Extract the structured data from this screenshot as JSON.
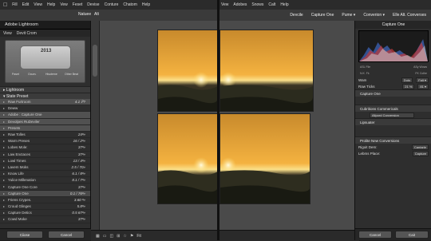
{
  "menubar_left": {
    "apple": "",
    "items": [
      "Fill",
      "Edit",
      "View",
      "Help",
      "Vew",
      "Feset",
      "Devise",
      "Conture",
      "Chatom",
      "Help"
    ]
  },
  "menubar_right": {
    "items": [
      "Vew",
      "Adobes",
      "Snows",
      "Calt",
      "Help"
    ]
  },
  "toolbar": {
    "center_left": "Natuee",
    "center_mid": "Alt",
    "right_items": [
      "Devcile",
      "Capture One",
      "Pume ▾",
      "Converion ▾",
      "Elle Alt. Converses"
    ]
  },
  "left_panel": {
    "title": "Adobe Lightroom",
    "tabs": [
      "View",
      "Devit Crom"
    ],
    "preview": {
      "year": "2013",
      "captions": [
        "Paset",
        "Ooum.",
        "Hisoteme",
        "Other Beat"
      ]
    },
    "section1": "Lightroom",
    "section2": "State Preset",
    "rows": [
      {
        "label": "Raw Furtroom",
        "val": "4.1 ℙ?"
      },
      {
        "label": "Deww",
        "val": ""
      },
      {
        "label": "Adobe : Capture One",
        "val": ""
      },
      {
        "label": "Devolpes RuDeviler",
        "val": ""
      },
      {
        "label": "Presets",
        "val": ""
      },
      {
        "label": "Raw Tolles",
        "val": "24ᵃ»"
      },
      {
        "label": "Warm Preses",
        "val": "16 / 2ᵃ»"
      },
      {
        "label": "Lobes Mole:",
        "val": "37ᵃ»"
      },
      {
        "label": "Law Enctaces",
        "val": "37ᵃ»"
      },
      {
        "label": "Lowl Times",
        "val": "13 / 4ᵃ»"
      },
      {
        "label": "Lavem Moks",
        "val": "2.5 / 70»"
      },
      {
        "label": "Know Life",
        "val": "6.1 / 8ᵃ»"
      },
      {
        "label": "Yulice Millenation",
        "val": "8.1 / 7ᵃ»"
      },
      {
        "label": "Capture One Core",
        "val": "37ᵃ»"
      },
      {
        "label": "Capture One",
        "val": "0.1 / 76ᵃ»"
      },
      {
        "label": "Friens Crypes.",
        "val": "3.60 ᵃ»"
      },
      {
        "label": "Croud Glinges",
        "val": "5.8ᵃ»"
      },
      {
        "label": "Capture Detics",
        "val": "0.5 67ᵃ»"
      },
      {
        "label": "Cowd Moke",
        "val": "37ᵃ»"
      }
    ],
    "buttons": [
      "Ciiose",
      "Cancel"
    ]
  },
  "filmstrip": {
    "icons": [
      "grid-icon",
      "loupe-icon",
      "compare-icon",
      "survey-icon",
      "star-icon",
      "flag-icon"
    ],
    "zoom": "Fit"
  },
  "right_panel": {
    "title": "Capture One",
    "hist_labels": [
      "ASL File",
      "ASy Wows"
    ],
    "hist_readout": [
      "N.K. Fk",
      "FK Colhe"
    ],
    "controls": [
      {
        "label": "Wam",
        "mid": "Duto",
        "val": "Falt ▾"
      },
      {
        "label": "Raw Ticks",
        "mid": "21 %",
        "val": "81 ▾"
      }
    ],
    "sections": [
      {
        "label": "Capture One"
      },
      {
        "label": "Cubritions Commericals"
      },
      {
        "label": "Lipsuater"
      },
      {
        "label": "Prolite New Conversions"
      }
    ],
    "adj_label": "Allpord Conversion",
    "fields": [
      {
        "label": "Rigoit Dem:",
        "val": "Cantarle"
      },
      {
        "label": "Lebms Place:",
        "val": "Capture"
      }
    ],
    "buttons": [
      "Cancel",
      "Cait"
    ]
  },
  "colors": {
    "accent": "#f0a030",
    "panel": "#2e2e2e"
  }
}
